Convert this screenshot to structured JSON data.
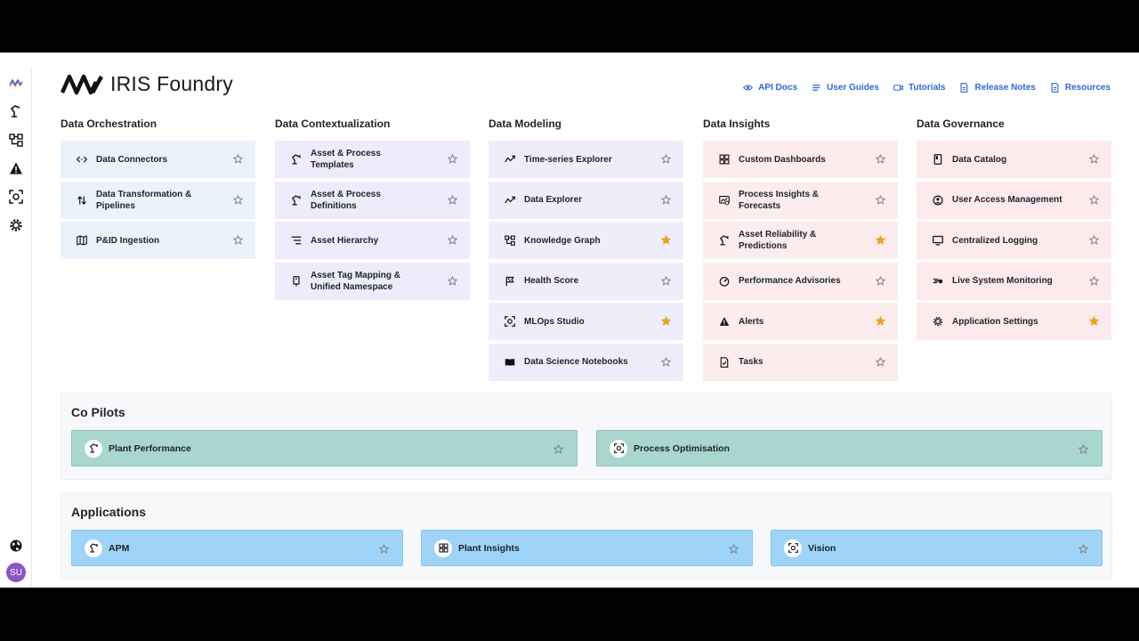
{
  "brand": {
    "name": "IRIS Foundry"
  },
  "user": {
    "initials": "SU"
  },
  "toplinks": [
    {
      "label": "API Docs",
      "icon": "eye-icon"
    },
    {
      "label": "User Guides",
      "icon": "list-icon"
    },
    {
      "label": "Tutorials",
      "icon": "video-icon"
    },
    {
      "label": "Release Notes",
      "icon": "document-icon"
    },
    {
      "label": "Resources",
      "icon": "document-icon"
    }
  ],
  "columns": [
    {
      "title": "Data Orchestration",
      "items": [
        {
          "label": "Data Connectors",
          "icon": "connector-icon",
          "starred": false
        },
        {
          "label": "Data Transformation & Pipelines",
          "icon": "transform-icon",
          "starred": false
        },
        {
          "label": "P&ID Ingestion",
          "icon": "map-icon",
          "starred": false
        }
      ]
    },
    {
      "title": "Data Contextualization",
      "items": [
        {
          "label": "Asset & Process Templates",
          "icon": "robot-arm-icon",
          "starred": false
        },
        {
          "label": "Asset & Process Definitions",
          "icon": "robot-arm-icon",
          "starred": false
        },
        {
          "label": "Asset Hierarchy",
          "icon": "hierarchy-icon",
          "starred": false
        },
        {
          "label": "Asset Tag Mapping & Unified Namespace",
          "icon": "tag-icon",
          "starred": false
        }
      ]
    },
    {
      "title": "Data Modeling",
      "items": [
        {
          "label": "Time-series Explorer",
          "icon": "trend-icon",
          "starred": false
        },
        {
          "label": "Data Explorer",
          "icon": "trend-icon",
          "starred": false
        },
        {
          "label": "Knowledge Graph",
          "icon": "graph-icon",
          "starred": true
        },
        {
          "label": "Health Score",
          "icon": "flag-icon",
          "starred": false
        },
        {
          "label": "MLOps Studio",
          "icon": "focus-icon",
          "starred": true
        },
        {
          "label": "Data Science Notebooks",
          "icon": "book-icon",
          "starred": false
        }
      ]
    },
    {
      "title": "Data Insights",
      "items": [
        {
          "label": "Custom Dashboards",
          "icon": "dashboard-icon",
          "starred": false
        },
        {
          "label": "Process Insights & Forecasts",
          "icon": "insights-icon",
          "starred": false
        },
        {
          "label": "Asset Reliability & Predictions",
          "icon": "robot-arm-icon",
          "starred": true
        },
        {
          "label": "Performance Advisories",
          "icon": "gauge-icon",
          "starred": false
        },
        {
          "label": "Alerts",
          "icon": "warning-icon",
          "starred": true
        },
        {
          "label": "Tasks",
          "icon": "task-icon",
          "starred": false
        }
      ]
    },
    {
      "title": "Data Governance",
      "items": [
        {
          "label": "Data Catalog",
          "icon": "catalog-icon",
          "starred": false
        },
        {
          "label": "User Access Management",
          "icon": "user-circle-icon",
          "starred": false
        },
        {
          "label": "Centralized Logging",
          "icon": "monitor-icon",
          "starred": false
        },
        {
          "label": "Live System Monitoring",
          "icon": "monitoring-icon",
          "starred": false
        },
        {
          "label": "Application Settings",
          "icon": "gear-icon",
          "starred": true
        }
      ]
    }
  ],
  "copilots": {
    "title": "Co Pilots",
    "items": [
      {
        "label": "Plant Performance",
        "icon": "robot-arm-icon",
        "starred": false
      },
      {
        "label": "Process Optimisation",
        "icon": "focus-icon",
        "starred": false
      }
    ]
  },
  "applications": {
    "title": "Applications",
    "items": [
      {
        "label": "APM",
        "icon": "robot-arm-icon",
        "starred": false
      },
      {
        "label": "Plant Insights",
        "icon": "dashboard-icon",
        "starred": false
      },
      {
        "label": "Vision",
        "icon": "focus-icon",
        "starred": false
      }
    ]
  },
  "colors": {
    "link": "#2a6ad8",
    "star_on": "#e8a320",
    "star_off": "#7a7f87"
  }
}
